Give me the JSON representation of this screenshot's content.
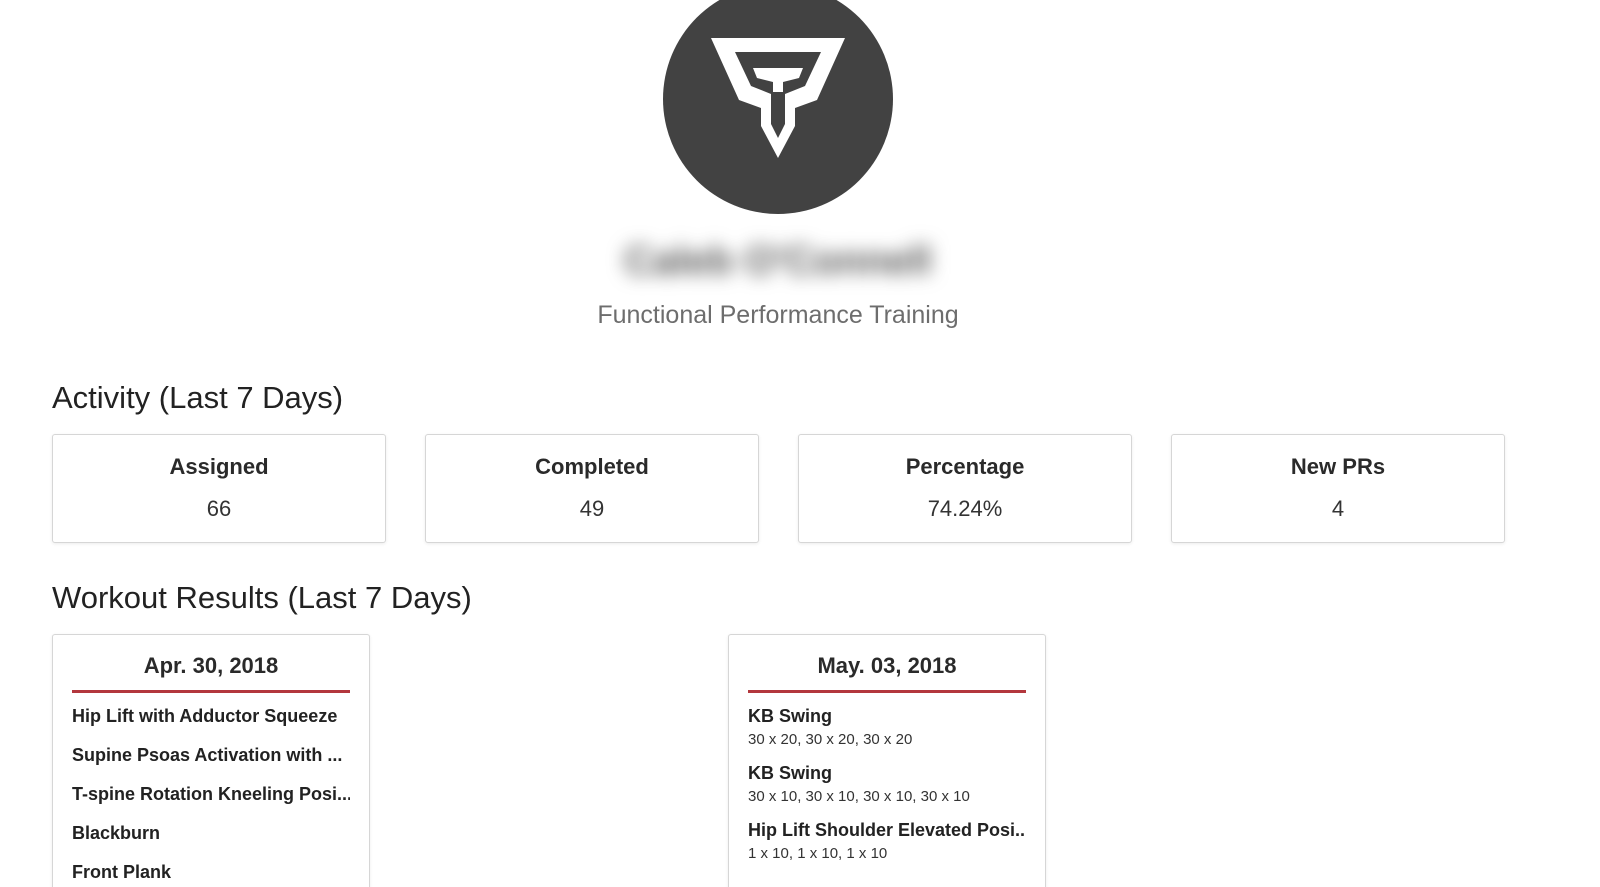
{
  "profile": {
    "name": "Caleb O'Connell",
    "subtitle": "Functional Performance Training"
  },
  "activity": {
    "title": "Activity (Last 7 Days)",
    "stats": [
      {
        "label": "Assigned",
        "value": "66"
      },
      {
        "label": "Completed",
        "value": "49"
      },
      {
        "label": "Percentage",
        "value": "74.24%"
      },
      {
        "label": "New PRs",
        "value": "4"
      }
    ]
  },
  "workouts": {
    "title": "Workout Results (Last 7 Days)",
    "days": [
      {
        "date": "Apr. 30, 2018",
        "exercises": [
          {
            "name": "Hip Lift with Adductor Squeeze",
            "sets": ""
          },
          {
            "name": "Supine Psoas Activation with ...",
            "sets": ""
          },
          {
            "name": "T-spine Rotation Kneeling Posi...",
            "sets": ""
          },
          {
            "name": "Blackburn",
            "sets": ""
          },
          {
            "name": "Front Plank",
            "sets": ""
          }
        ]
      },
      {
        "date": "May. 03, 2018",
        "exercises": [
          {
            "name": "KB Swing",
            "sets": "30 x 20, 30 x 20, 30 x 20"
          },
          {
            "name": "KB Swing",
            "sets": "30 x 10, 30 x 10, 30 x 10, 30 x 10"
          },
          {
            "name": "Hip Lift Shoulder Elevated Posi...",
            "sets": "1 x 10, 1 x 10, 1 x 10"
          }
        ]
      }
    ]
  },
  "colors": {
    "avatar_bg": "#424242",
    "accent_underline": "#b3373d"
  },
  "icons": {
    "logo": "trident-logo-icon"
  }
}
